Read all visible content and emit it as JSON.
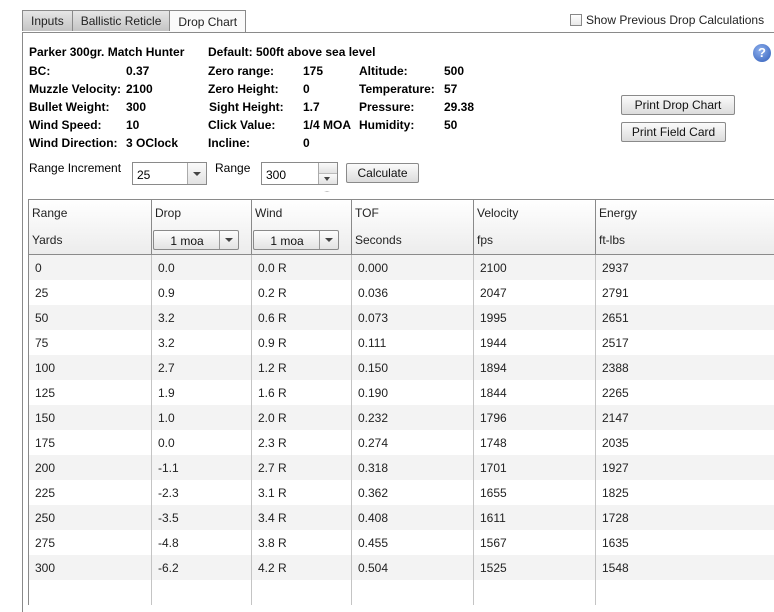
{
  "tabs": [
    {
      "label": "Inputs",
      "active": false
    },
    {
      "label": "Ballistic Reticle",
      "active": false
    },
    {
      "label": "Drop Chart",
      "active": true
    }
  ],
  "show_previous": {
    "label": "Show Previous Drop Calculations",
    "checked": false
  },
  "summary": {
    "title": "Parker 300gr. Match Hunter",
    "default_note": "Default: 500ft above sea level",
    "col1": [
      {
        "label": "BC:",
        "value": "0.37"
      },
      {
        "label": "Muzzle Velocity:",
        "value": "2100"
      },
      {
        "label": "Bullet Weight:",
        "value": "300"
      },
      {
        "label": "Wind Speed:",
        "value": "10"
      },
      {
        "label": "Wind Direction:",
        "value": "3 OClock"
      }
    ],
    "col2": [
      {
        "label": "Zero range:",
        "value": "175"
      },
      {
        "label": "Zero Height:",
        "value": "0"
      },
      {
        "label": "Sight Height:",
        "value": "1.7"
      },
      {
        "label": "Click Value:",
        "value": "1/4 MOA"
      },
      {
        "label": "Incline:",
        "value": "0"
      }
    ],
    "col3": [
      {
        "label": "Altitude:",
        "value": "500"
      },
      {
        "label": "Temperature:",
        "value": "57"
      },
      {
        "label": "Pressure:",
        "value": "29.38"
      },
      {
        "label": "Humidity:",
        "value": "50"
      }
    ]
  },
  "help_icon": "?",
  "buttons": {
    "print_drop_chart": "Print Drop Chart",
    "print_field_card": "Print Field Card",
    "calculate": "Calculate"
  },
  "controls": {
    "range_increment_label": "Range Increment",
    "range_increment_value": "25",
    "range_label": "Range",
    "range_value": "300"
  },
  "table": {
    "columns": [
      {
        "title": "Range",
        "unit": "Yards"
      },
      {
        "title": "Drop",
        "unit_select": "1 moa"
      },
      {
        "title": "Wind",
        "unit_select": "1 moa"
      },
      {
        "title": "TOF",
        "unit": "Seconds"
      },
      {
        "title": "Velocity",
        "unit": "fps"
      },
      {
        "title": "Energy",
        "unit": "ft-lbs"
      }
    ],
    "rows": [
      [
        "0",
        "0.0",
        "0.0 R",
        "0.000",
        "2100",
        "2937"
      ],
      [
        "25",
        "0.9",
        "0.2 R",
        "0.036",
        "2047",
        "2791"
      ],
      [
        "50",
        "3.2",
        "0.6 R",
        "0.073",
        "1995",
        "2651"
      ],
      [
        "75",
        "3.2",
        "0.9 R",
        "0.111",
        "1944",
        "2517"
      ],
      [
        "100",
        "2.7",
        "1.2 R",
        "0.150",
        "1894",
        "2388"
      ],
      [
        "125",
        "1.9",
        "1.6 R",
        "0.190",
        "1844",
        "2265"
      ],
      [
        "150",
        "1.0",
        "2.0 R",
        "0.232",
        "1796",
        "2147"
      ],
      [
        "175",
        "0.0",
        "2.3 R",
        "0.274",
        "1748",
        "2035"
      ],
      [
        "200",
        "-1.1",
        "2.7 R",
        "0.318",
        "1701",
        "1927"
      ],
      [
        "225",
        "-2.3",
        "3.1 R",
        "0.362",
        "1655",
        "1825"
      ],
      [
        "250",
        "-3.5",
        "3.4 R",
        "0.408",
        "1611",
        "1728"
      ],
      [
        "275",
        "-4.8",
        "3.8 R",
        "0.455",
        "1567",
        "1635"
      ],
      [
        "300",
        "-6.2",
        "4.2 R",
        "0.504",
        "1525",
        "1548"
      ]
    ]
  }
}
